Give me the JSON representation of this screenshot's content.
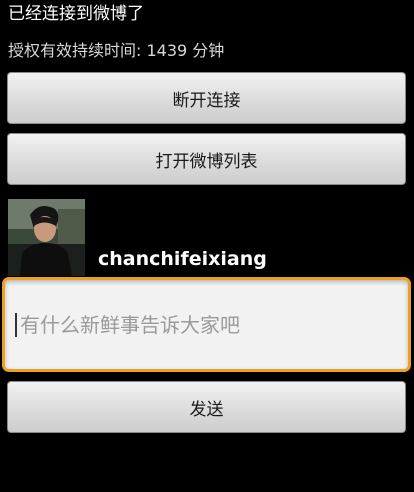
{
  "status": {
    "title": "已经连接到微博了",
    "auth_time": "授权有效持续时间: 1439 分钟"
  },
  "buttons": {
    "disconnect_label": "断开连接",
    "open_list_label": "打开微博列表",
    "send_label": "发送"
  },
  "user": {
    "name": "chanchifeixiang"
  },
  "compose": {
    "placeholder": "有什么新鲜事告诉大家吧"
  },
  "colors": {
    "background": "#000000",
    "focus_border": "#f0a020",
    "button_face": "#dcdcdc"
  }
}
